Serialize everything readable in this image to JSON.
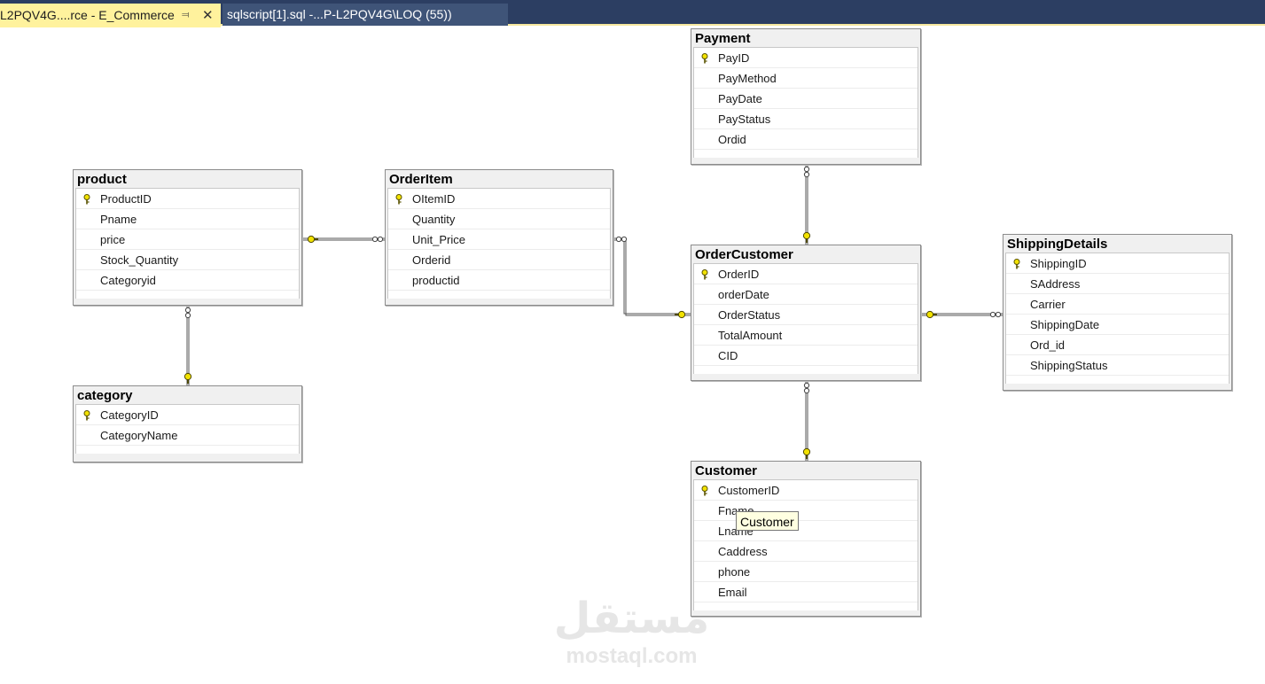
{
  "tabs": [
    {
      "label": "L2PQV4G....rce - E_Commerce",
      "active": true,
      "pin_icon": "pin-icon",
      "close_icon": "close-icon"
    },
    {
      "label": "sqlscript[1].sql -...P-L2PQV4G\\LOQ (55))",
      "active": false
    }
  ],
  "tables": {
    "payment": {
      "title": "Payment",
      "columns": [
        "PayID",
        "PayMethod",
        "PayDate",
        "PayStatus",
        "Ordid"
      ],
      "primary_key": "PayID"
    },
    "product": {
      "title": "product",
      "columns": [
        "ProductID",
        "Pname",
        "price",
        "Stock_Quantity",
        "Categoryid"
      ],
      "primary_key": "ProductID"
    },
    "orderitem": {
      "title": "OrderItem",
      "columns": [
        "OItemID",
        "Quantity",
        "Unit_Price",
        "Orderid",
        "productid"
      ],
      "primary_key": "OItemID"
    },
    "ordercustomer": {
      "title": "OrderCustomer",
      "columns": [
        "OrderID",
        "orderDate",
        "OrderStatus",
        "TotalAmount",
        "CID"
      ],
      "primary_key": "OrderID"
    },
    "shippingdetails": {
      "title": "ShippingDetails",
      "columns": [
        "ShippingID",
        "SAddress",
        "Carrier",
        "ShippingDate",
        "Ord_id",
        "ShippingStatus"
      ],
      "primary_key": "ShippingID"
    },
    "category": {
      "title": "category",
      "columns": [
        "CategoryID",
        "CategoryName"
      ],
      "primary_key": "CategoryID"
    },
    "customer": {
      "title": "Customer",
      "columns": [
        "CustomerID",
        "Fname",
        "Lname",
        "Caddress",
        "phone",
        "Email"
      ],
      "primary_key": "CustomerID"
    }
  },
  "relationships": [
    {
      "from": "product",
      "to": "orderitem"
    },
    {
      "from": "category",
      "to": "product"
    },
    {
      "from": "ordercustomer",
      "to": "orderitem"
    },
    {
      "from": "ordercustomer",
      "to": "payment"
    },
    {
      "from": "ordercustomer",
      "to": "shippingdetails"
    },
    {
      "from": "customer",
      "to": "ordercustomer"
    }
  ],
  "tooltip": {
    "text": "Customer"
  },
  "watermark": {
    "arabic": "مستقل",
    "latin": "mostaql.com"
  },
  "colors": {
    "tab_bar": "#2c3e62",
    "active_tab": "#fff29d",
    "key_gold": "#f2e200",
    "line": "#555555"
  }
}
